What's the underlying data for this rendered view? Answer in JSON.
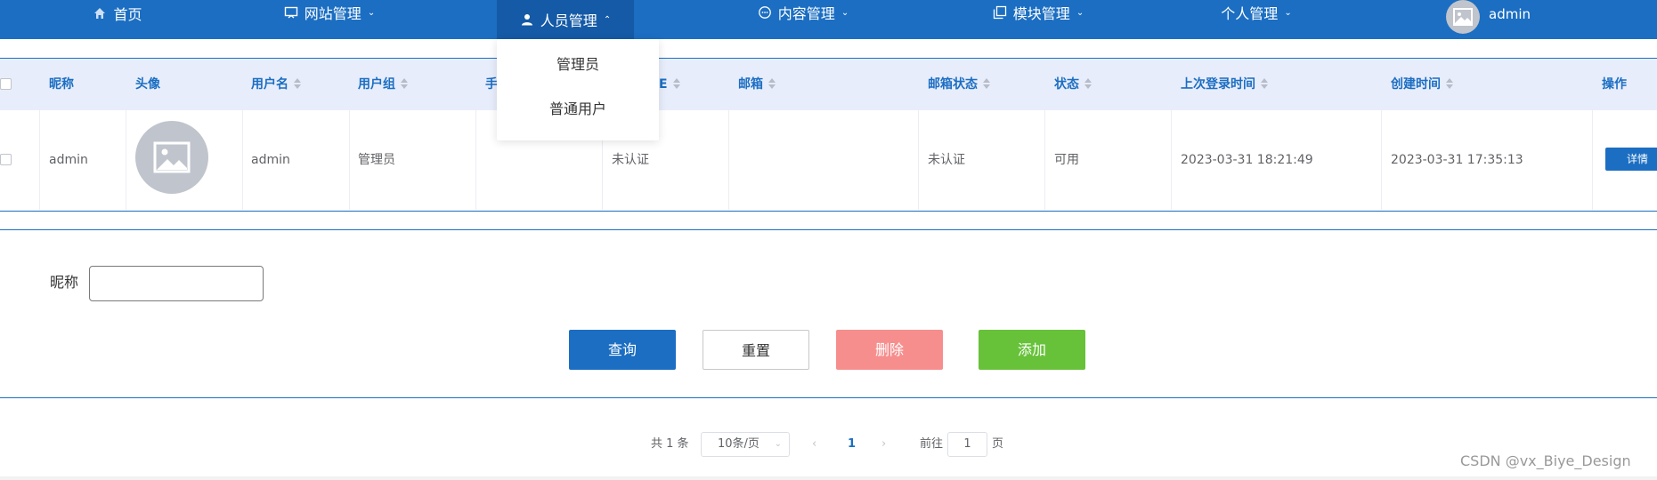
{
  "nav": {
    "items": [
      {
        "label": "首页",
        "icon": "home-icon"
      },
      {
        "label": "网站管理",
        "icon": "monitor-icon"
      },
      {
        "label": "人员管理",
        "icon": "user-icon"
      },
      {
        "label": "内容管理",
        "icon": "chat-icon"
      },
      {
        "label": "模块管理",
        "icon": "copy-icon"
      },
      {
        "label": "个人管理"
      }
    ],
    "active_index": 2,
    "user_name": "admin",
    "accent_color": "#1b6ec2"
  },
  "dropdown": {
    "items": [
      "管理员",
      "普通用户"
    ]
  },
  "table": {
    "headers": [
      "昵称",
      "头像",
      "用户名",
      "用户组",
      "手",
      "E",
      "邮箱",
      "邮箱状态",
      "状态",
      "上次登录时间",
      "创建时间",
      "操作"
    ],
    "rows": [
      {
        "nickname": "admin",
        "username": "admin",
        "group": "管理员",
        "phone": "",
        "cert_state": "未认证",
        "email": "",
        "email_state": "未认证",
        "status": "可用",
        "last_login": "2023-03-31 18:21:49",
        "created": "2023-03-31 17:35:13",
        "action": "详情"
      }
    ]
  },
  "search": {
    "label": "昵称",
    "value": ""
  },
  "buttons": {
    "query": "查询",
    "reset": "重置",
    "delete": "删除",
    "add": "添加",
    "delete_color": "#f78e8e",
    "add_color": "#67c23a"
  },
  "pagination": {
    "total": "共 1 条",
    "page_size": "10条/页",
    "current_page": "1",
    "goto_label": "前往",
    "goto_value": "1",
    "page_suffix": "页"
  },
  "watermark": "CSDN @vx_Biye_Design"
}
